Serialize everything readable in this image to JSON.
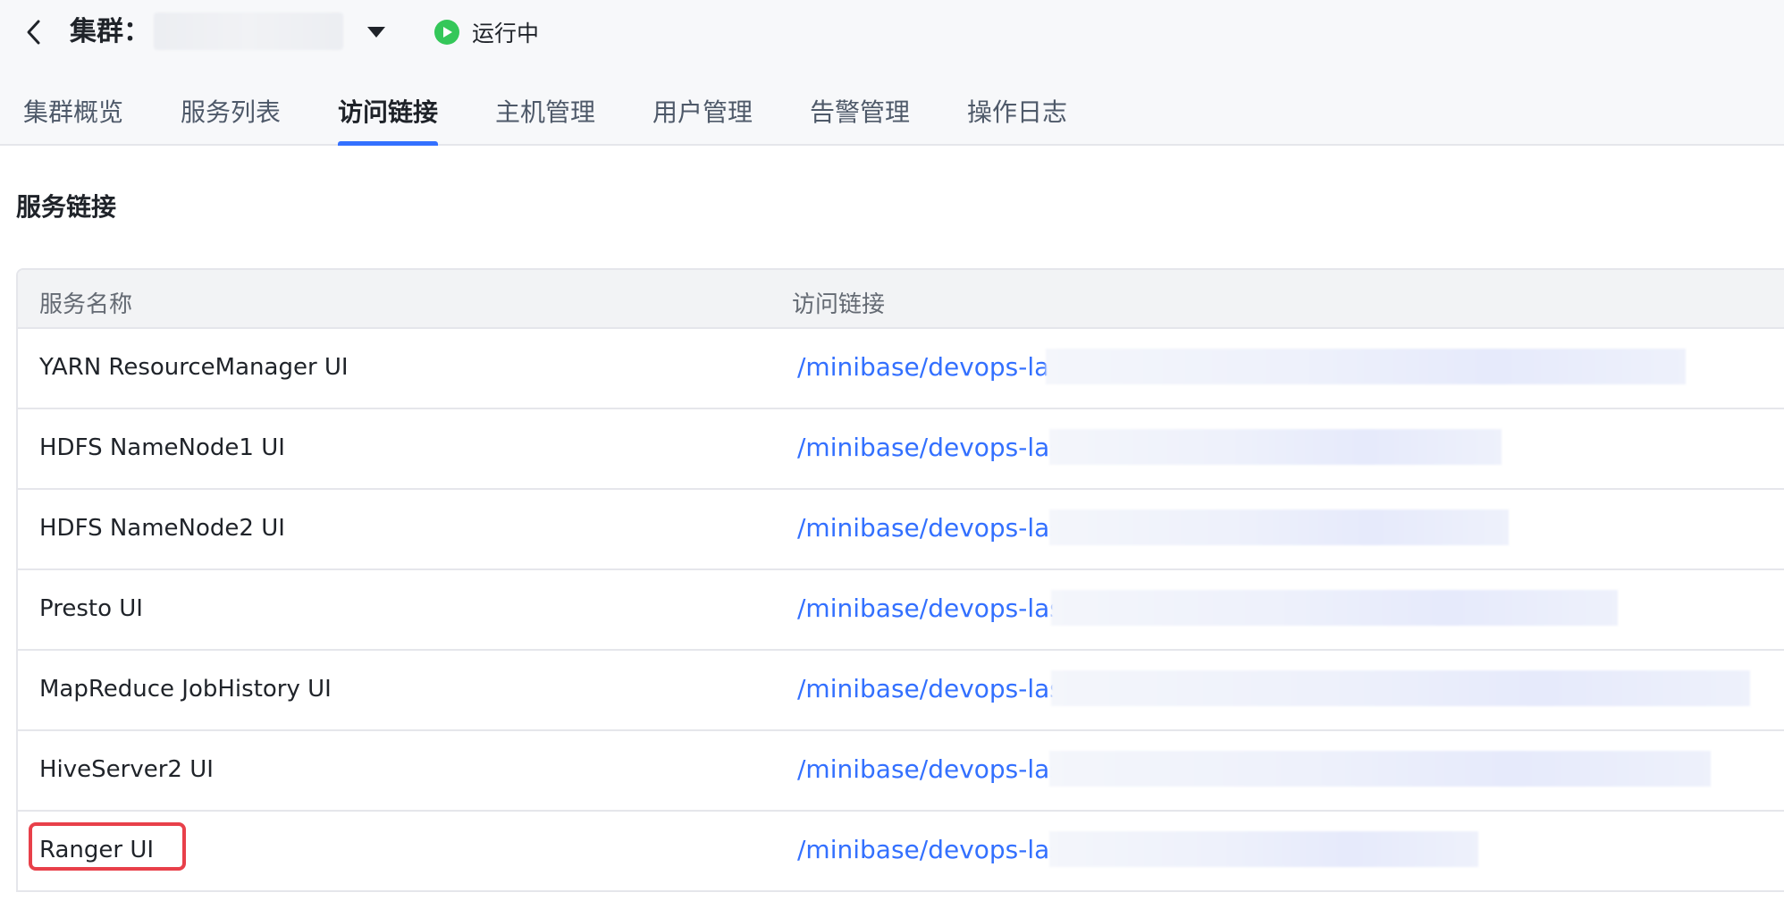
{
  "header": {
    "cluster_label": "集群：",
    "status_text": "运行中",
    "colors": {
      "status": "#34c759",
      "accent": "#3370ff",
      "highlight": "#e8404a"
    }
  },
  "tabs": [
    {
      "label": "集群概览",
      "active": false
    },
    {
      "label": "服务列表",
      "active": false
    },
    {
      "label": "访问链接",
      "active": true
    },
    {
      "label": "主机管理",
      "active": false
    },
    {
      "label": "用户管理",
      "active": false
    },
    {
      "label": "告警管理",
      "active": false
    },
    {
      "label": "操作日志",
      "active": false
    }
  ],
  "section": {
    "title": "服务链接"
  },
  "table": {
    "columns": [
      "服务名称",
      "访问链接"
    ],
    "rows": [
      {
        "name": "YARN ResourceManager UI",
        "link": "/minibase/devops-las"
      },
      {
        "name": "HDFS NameNode1 UI",
        "link": "/minibase/devops-las/"
      },
      {
        "name": "HDFS NameNode2 UI",
        "link": "/minibase/devops-las/"
      },
      {
        "name": "Presto UI",
        "link": "/minibase/devops-las/"
      },
      {
        "name": "MapReduce JobHistory UI",
        "link": "/minibase/devops-las/"
      },
      {
        "name": "HiveServer2 UI",
        "link": "/minibase/devops-las/"
      },
      {
        "name": "Ranger UI",
        "link": "/minibase/devops-las/"
      }
    ]
  }
}
